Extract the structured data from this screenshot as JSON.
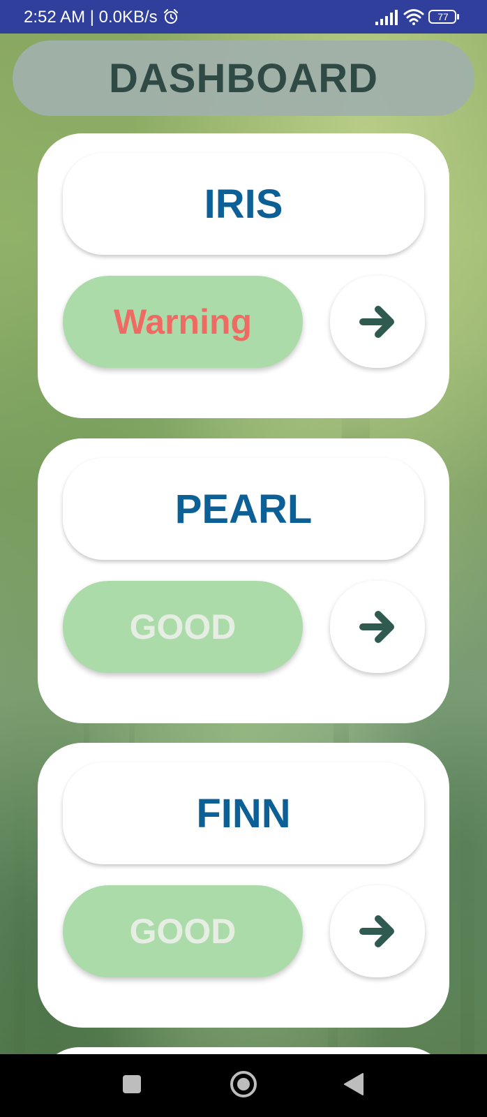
{
  "status_bar": {
    "time": "2:52 AM | 0.0KB/s",
    "battery": "77",
    "icons": [
      "alarm-icon",
      "signal-icon",
      "wifi-icon",
      "battery-icon"
    ]
  },
  "header": {
    "title": "DASHBOARD"
  },
  "cards": [
    {
      "name": "IRIS",
      "status": "Warning",
      "status_color": "#f06a64",
      "arrow_icon": "arrow-right-icon"
    },
    {
      "name": "PEARL",
      "status": "GOOD",
      "status_color": "#e6eee4",
      "arrow_icon": "arrow-right-icon"
    },
    {
      "name": "FINN",
      "status": "GOOD",
      "status_color": "#e6eee4",
      "arrow_icon": "arrow-right-icon"
    }
  ],
  "colors": {
    "status_bar": "#2f3f9b",
    "header_bg": "#a0b0aa",
    "header_text": "#2f4a45",
    "name_text": "#0d6096",
    "status_pill": "#acdbaa",
    "arrow": "#2e5a4f"
  },
  "nav_bar": {
    "icons": [
      "recents-icon",
      "home-icon",
      "back-icon"
    ]
  }
}
